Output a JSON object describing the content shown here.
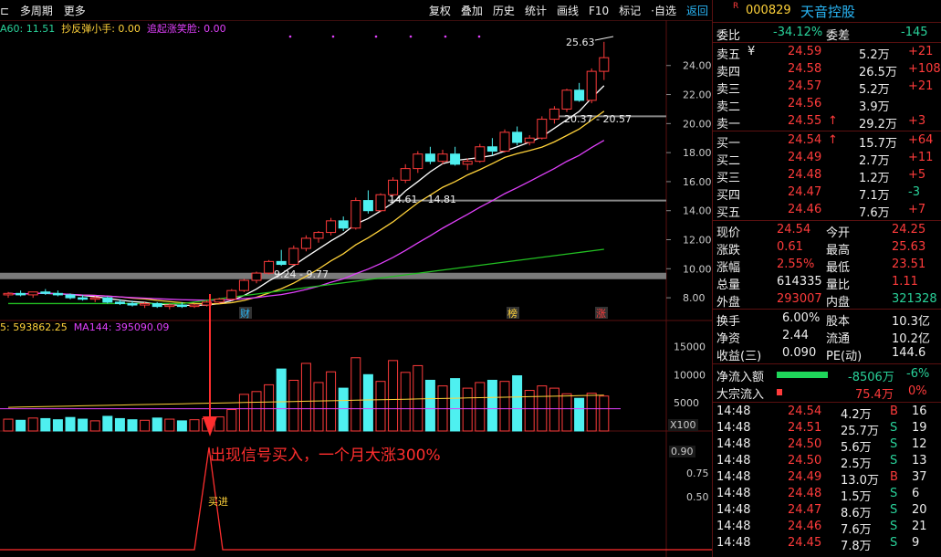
{
  "topbar": {
    "left": [
      "多周期",
      "更多"
    ],
    "right": [
      "复权",
      "叠加",
      "历史",
      "统计",
      "画线",
      "F10",
      "标记",
      "·自选"
    ],
    "back": "返回"
  },
  "ma_line": {
    "a": "A60: 11.51",
    "b": "抄反弹小手: 0.00",
    "c": "追起涨笑脸: 0.00"
  },
  "vol_line": {
    "a": "5: 593862.25",
    "b": "MA144: 395090.09"
  },
  "chart_data": {
    "type": "candlestick",
    "y_ticks": [
      "24.00",
      "22.00",
      "20.00",
      "18.00",
      "16.00",
      "14.00",
      "12.00",
      "10.00",
      "8.00"
    ],
    "ylim": [
      7.0,
      26.5
    ],
    "vol_ticks": [
      "15000",
      "10000",
      "5000"
    ],
    "vol_unit": "X100",
    "ind_ticks": [
      "0.90",
      "0.75",
      "0.50"
    ],
    "labels": {
      "high": "25.63",
      "r1": "20.37 - 20.57",
      "r2": "14.61 - 14.81",
      "r3": "9.24 - 9.77"
    },
    "markers": [
      "财",
      "榜",
      "涨"
    ],
    "candles": [
      [
        8.2,
        8.4,
        8.0,
        8.3
      ],
      [
        8.3,
        8.5,
        8.1,
        8.2
      ],
      [
        8.2,
        8.4,
        8.0,
        8.4
      ],
      [
        8.4,
        8.6,
        8.2,
        8.3
      ],
      [
        8.3,
        8.5,
        8.1,
        8.2
      ],
      [
        8.2,
        8.3,
        7.9,
        8.0
      ],
      [
        8.0,
        8.2,
        7.8,
        7.9
      ],
      [
        7.9,
        8.1,
        7.7,
        8.0
      ],
      [
        8.0,
        8.1,
        7.6,
        7.7
      ],
      [
        7.7,
        7.9,
        7.5,
        7.6
      ],
      [
        7.6,
        7.8,
        7.4,
        7.5
      ],
      [
        7.5,
        7.7,
        7.3,
        7.6
      ],
      [
        7.6,
        7.7,
        7.3,
        7.4
      ],
      [
        7.4,
        7.6,
        7.2,
        7.5
      ],
      [
        7.5,
        7.7,
        7.3,
        7.4
      ],
      [
        7.4,
        7.6,
        7.3,
        7.5
      ],
      [
        7.5,
        7.8,
        7.4,
        7.7
      ],
      [
        7.7,
        8.0,
        7.6,
        7.9
      ],
      [
        7.9,
        8.6,
        7.8,
        8.5
      ],
      [
        8.5,
        9.3,
        8.4,
        9.2
      ],
      [
        9.2,
        9.8,
        9.0,
        9.7
      ],
      [
        9.7,
        10.6,
        9.6,
        10.5
      ],
      [
        10.5,
        11.3,
        10.2,
        10.3
      ],
      [
        10.3,
        11.6,
        10.2,
        11.4
      ],
      [
        11.4,
        12.3,
        11.2,
        12.1
      ],
      [
        12.1,
        12.6,
        11.8,
        12.5
      ],
      [
        12.5,
        13.5,
        12.3,
        13.3
      ],
      [
        13.3,
        13.6,
        12.6,
        12.8
      ],
      [
        12.8,
        14.9,
        12.7,
        14.7
      ],
      [
        14.7,
        15.4,
        13.8,
        14.0
      ],
      [
        14.0,
        15.2,
        13.9,
        15.1
      ],
      [
        15.1,
        16.3,
        15.0,
        16.1
      ],
      [
        16.1,
        17.2,
        15.9,
        16.9
      ],
      [
        16.9,
        18.1,
        16.6,
        17.9
      ],
      [
        17.9,
        18.4,
        17.2,
        17.4
      ],
      [
        17.4,
        18.2,
        17.2,
        17.9
      ],
      [
        17.9,
        18.4,
        17.1,
        17.2
      ],
      [
        17.2,
        17.6,
        16.8,
        17.4
      ],
      [
        17.4,
        18.6,
        17.3,
        18.4
      ],
      [
        18.4,
        19.0,
        17.8,
        18.1
      ],
      [
        18.1,
        19.6,
        18.0,
        19.4
      ],
      [
        19.4,
        19.8,
        18.5,
        18.7
      ],
      [
        18.7,
        19.2,
        18.5,
        19.0
      ],
      [
        19.0,
        20.5,
        18.9,
        20.3
      ],
      [
        20.3,
        21.2,
        20.0,
        21.0
      ],
      [
        21.0,
        22.4,
        20.8,
        22.3
      ],
      [
        22.3,
        22.8,
        21.5,
        21.6
      ],
      [
        21.6,
        23.8,
        21.4,
        23.6
      ],
      [
        23.6,
        25.63,
        23.0,
        24.54
      ]
    ],
    "vol": [
      2100,
      1900,
      2300,
      2200,
      2000,
      2400,
      2100,
      1800,
      2600,
      2200,
      2000,
      1900,
      2300,
      2100,
      1800,
      2000,
      2200,
      2500,
      3800,
      6500,
      7000,
      8200,
      11000,
      9000,
      12000,
      8600,
      10500,
      7600,
      13000,
      10000,
      8800,
      12500,
      10400,
      11600,
      9000,
      8000,
      9300,
      7600,
      8600,
      9000,
      8800,
      9800,
      7200,
      8000,
      7600,
      6600,
      5800,
      6700,
      6200
    ]
  },
  "side": {
    "code": "000829",
    "name": "天音控股",
    "r": "R",
    "webi_l": "委比",
    "webi": "-34.12%",
    "wecha_l": "委差",
    "wecha": "-145",
    "sell": [
      {
        "l": "卖五",
        "p": "24.59",
        "v": "5.2万",
        "d": "+21",
        "y": "¥"
      },
      {
        "l": "卖四",
        "p": "24.58",
        "v": "26.5万",
        "d": "+108"
      },
      {
        "l": "卖三",
        "p": "24.57",
        "v": "5.2万",
        "d": "+21"
      },
      {
        "l": "卖二",
        "p": "24.56",
        "v": "3.9万",
        "d": ""
      },
      {
        "l": "卖一",
        "p": "24.55",
        "v": "29.2万",
        "d": "+3",
        "arr": "↑"
      }
    ],
    "buy": [
      {
        "l": "买一",
        "p": "24.54",
        "v": "15.7万",
        "d": "+64",
        "arr": "↑"
      },
      {
        "l": "买二",
        "p": "24.49",
        "v": "2.7万",
        "d": "+11"
      },
      {
        "l": "买三",
        "p": "24.48",
        "v": "1.2万",
        "d": "+5"
      },
      {
        "l": "买四",
        "p": "24.47",
        "v": "7.1万",
        "d": "-3"
      },
      {
        "l": "买五",
        "p": "24.46",
        "v": "7.6万",
        "d": "+7"
      }
    ],
    "stats": [
      {
        "a": "现价",
        "av": "24.54",
        "b": "今开",
        "bv": "24.25"
      },
      {
        "a": "涨跌",
        "av": "0.61",
        "b": "最高",
        "bv": "25.63"
      },
      {
        "a": "涨幅",
        "av": "2.55%",
        "b": "最低",
        "bv": "23.51"
      },
      {
        "a": "总量",
        "av": "614335",
        "b": "量比",
        "bv": "1.11"
      },
      {
        "a": "外盘",
        "av": "293007",
        "b": "内盘",
        "bv": "321328"
      }
    ],
    "stats2": [
      {
        "a": "换手",
        "av": "6.00%",
        "b": "股本",
        "bv": "10.3亿"
      },
      {
        "a": "净资",
        "av": "2.44",
        "b": "流通",
        "bv": "10.2亿"
      },
      {
        "a": "收益(三)",
        "av": "0.090",
        "b": "PE(动)",
        "bv": "144.6"
      }
    ],
    "flow1_l": "净流入额",
    "flow1": "-8506万",
    "flow1p": "-6%",
    "flow2_l": "大宗流入",
    "flow2": "75.4万",
    "flow2p": "0%",
    "ticks": [
      {
        "t": "14:48",
        "p": "24.54",
        "v": "4.2万",
        "s": "B",
        "n": "16"
      },
      {
        "t": "14:48",
        "p": "24.51",
        "v": "25.7万",
        "s": "S",
        "n": "19"
      },
      {
        "t": "14:48",
        "p": "24.50",
        "v": "5.6万",
        "s": "S",
        "n": "12"
      },
      {
        "t": "14:48",
        "p": "24.50",
        "v": "2.5万",
        "s": "S",
        "n": "13"
      },
      {
        "t": "14:48",
        "p": "24.49",
        "v": "13.0万",
        "s": "B",
        "n": "37"
      },
      {
        "t": "14:48",
        "p": "24.48",
        "v": "1.5万",
        "s": "S",
        "n": "6"
      },
      {
        "t": "14:48",
        "p": "24.47",
        "v": "8.6万",
        "s": "S",
        "n": "20"
      },
      {
        "t": "14:48",
        "p": "24.46",
        "v": "7.6万",
        "s": "S",
        "n": "21"
      },
      {
        "t": "14:48",
        "p": "24.45",
        "v": "7.8万",
        "s": "S",
        "n": "9"
      }
    ]
  },
  "annotation": "出现信号买入，一个月大涨300%",
  "buy_label": "买进"
}
